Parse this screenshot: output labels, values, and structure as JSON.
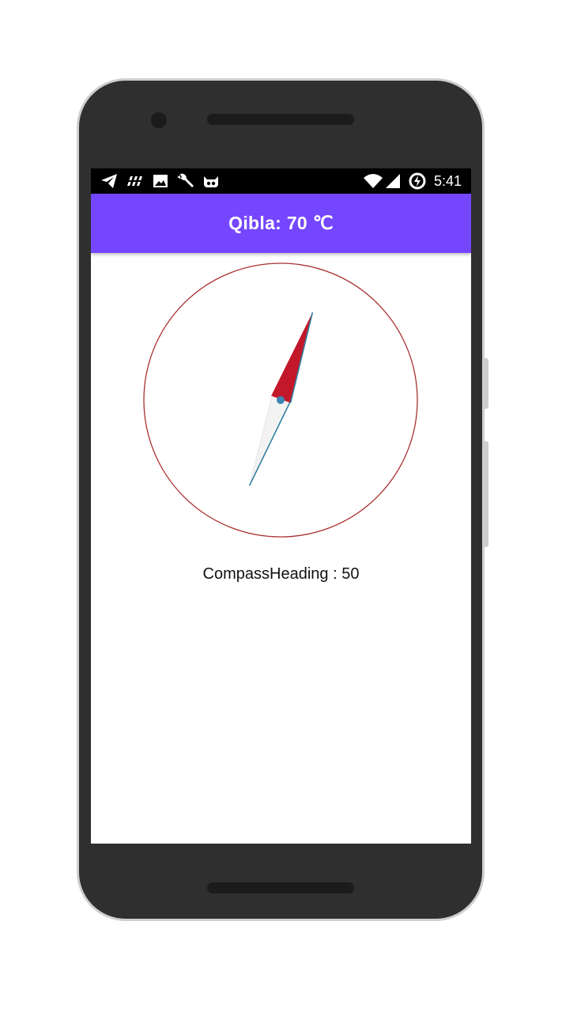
{
  "status_bar": {
    "time": "5:41",
    "left_icons": [
      "telegram-icon",
      "flipboard-icon",
      "image-icon",
      "wrench-icon",
      "cyanogen-icon"
    ],
    "right_icons": [
      "wifi-icon",
      "signal-icon",
      "battery-charging-icon"
    ]
  },
  "app_bar": {
    "title": "Qibla: 70 ℃"
  },
  "compass": {
    "heading_label": "CompassHeading : 50",
    "heading_degrees": 50,
    "ring_color": "#a8302e",
    "needle_north_color": "#c3182a",
    "needle_south_color": "#f3f3f3",
    "needle_edge_color": "#2e7fa0"
  },
  "colors": {
    "accent": "#7546ff",
    "status_bar": "#000000",
    "phone_body": "#2f2f2f"
  }
}
